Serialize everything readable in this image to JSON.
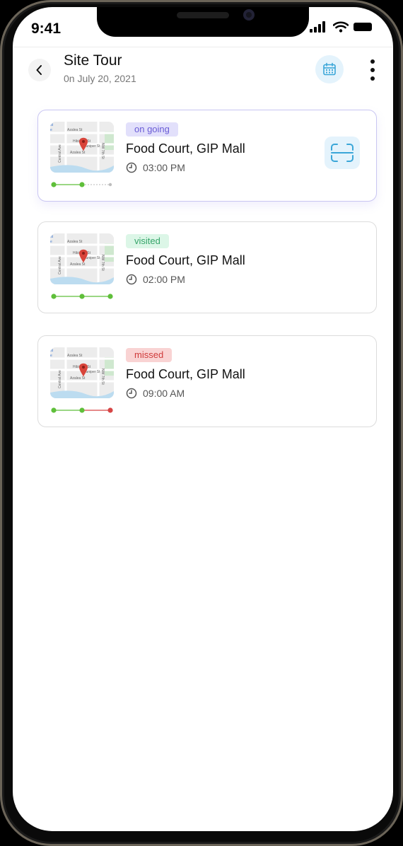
{
  "status_bar": {
    "time": "9:41"
  },
  "header": {
    "title": "Site Tour",
    "subtitle": "0n July 20, 2021"
  },
  "colors": {
    "accent": "#3aa6d8",
    "ongoing_bg": "#e2e0fb",
    "ongoing_fg": "#6a5cd6",
    "visited_bg": "#dcf6e7",
    "visited_fg": "#36a56a",
    "missed_bg": "#f9d3d3",
    "missed_fg": "#cf3b3b",
    "progress_green": "#5fbf3a",
    "progress_red": "#d64545"
  },
  "visits": [
    {
      "status": "on going",
      "status_key": "ongoing",
      "title": "Food Court, GIP Mall",
      "time": "03:00 PM",
      "steps_done": 2,
      "steps_total": 3,
      "has_scan": true
    },
    {
      "status": "visited",
      "status_key": "visited",
      "title": "Food Court, GIP Mall",
      "time": "02:00 PM",
      "steps_done": 3,
      "steps_total": 3,
      "has_scan": false
    },
    {
      "status": "missed",
      "status_key": "missed",
      "title": "Food Court, GIP Mall",
      "time": "09:00 AM",
      "steps_done": 2,
      "steps_total": 3,
      "has_scan": false
    }
  ],
  "map_labels": [
    "Azalea St",
    "Hibiscus St",
    "Juniper St",
    "Azalea St",
    "Central Ave",
    "NW 7th St"
  ],
  "icons": {
    "back": "chevron-left-icon",
    "calendar": "calendar-icon",
    "more": "more-vertical-icon",
    "scan": "scan-icon",
    "clock": "clock-icon",
    "pin": "map-pin-icon"
  }
}
